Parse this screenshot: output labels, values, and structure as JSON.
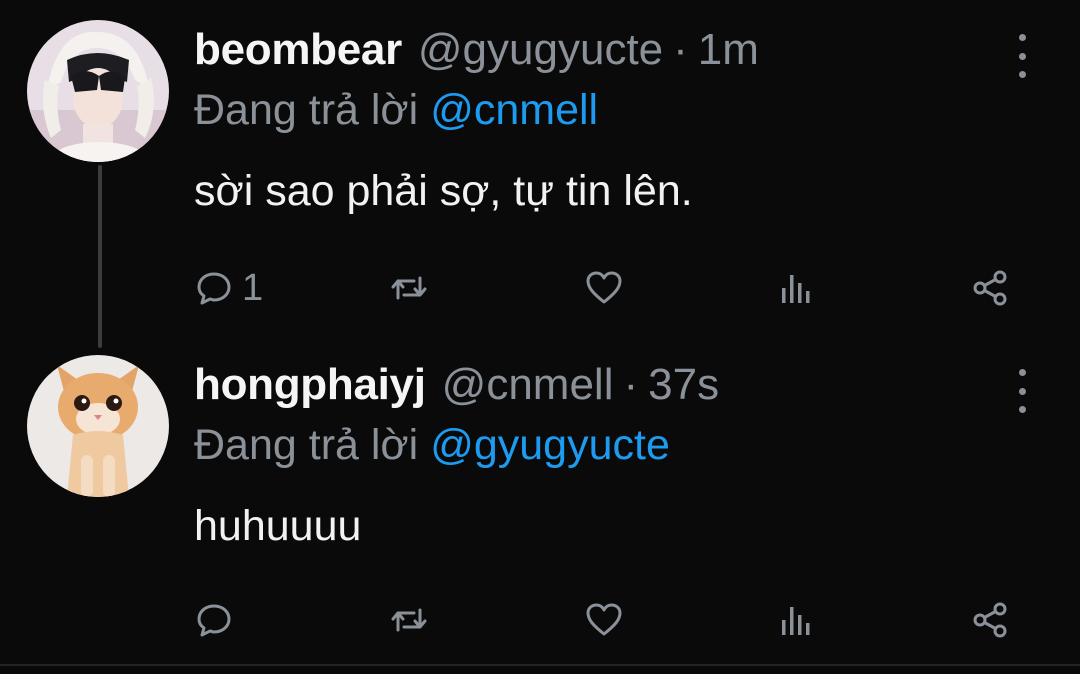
{
  "tweets": [
    {
      "display_name": "beombear",
      "handle": "@gyugyucte",
      "separator": "·",
      "time": "1m",
      "reply_prefix": "Đang trả lời",
      "reply_to": "@cnmell",
      "text": "sời sao phải sợ, tự tin lên.",
      "reply_count": "1",
      "avatar_icon": "person-with-white-bunny-hat"
    },
    {
      "display_name": "hongphaiyj",
      "handle": "@cnmell",
      "separator": "·",
      "time": "37s",
      "reply_prefix": "Đang trả lời",
      "reply_to": "@gyugyucte",
      "text": "huhuuuu",
      "reply_count": "",
      "avatar_icon": "orange-kitten"
    }
  ],
  "icons": {
    "reply": "comment-bubble-icon",
    "retweet": "retweet-icon",
    "like": "heart-icon",
    "views": "bar-chart-icon",
    "share": "share-icon",
    "more": "more-vertical-icon"
  },
  "colors": {
    "background": "#0a0a0a",
    "muted": "#8b9198",
    "accent": "#1d9bf0",
    "text": "#f2f2f2"
  }
}
